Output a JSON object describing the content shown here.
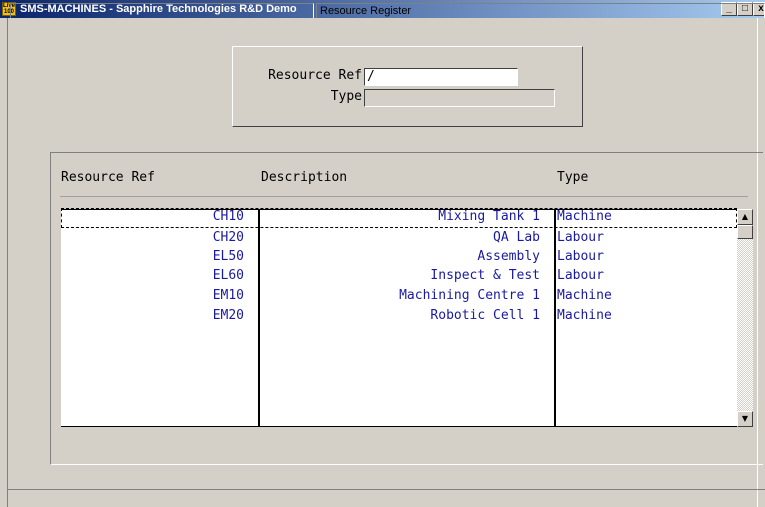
{
  "window": {
    "title": "SMS-MACHINES - Sapphire Technologies R&D Demo",
    "icon_text_top": "Live",
    "icon_text_bottom": "100",
    "minimize": "_",
    "maximize": "□",
    "close": "x"
  },
  "search": {
    "resource_ref_label": "Resource Ref",
    "resource_ref_value": "/",
    "type_label": "Type",
    "type_value": ""
  },
  "list": {
    "columns": [
      "Resource Ref",
      "Description",
      "Type"
    ],
    "rows": [
      {
        "ref": "CH10",
        "description": "Mixing Tank 1",
        "type": "Machine"
      },
      {
        "ref": "CH20",
        "description": "QA Lab",
        "type": "Labour"
      },
      {
        "ref": "EL50",
        "description": "Assembly",
        "type": "Labour"
      },
      {
        "ref": "EL60",
        "description": "Inspect & Test",
        "type": "Labour"
      },
      {
        "ref": "EM10",
        "description": "Machining Centre 1",
        "type": "Machine"
      },
      {
        "ref": "EM20",
        "description": "Robotic Cell 1",
        "type": "Machine"
      }
    ],
    "selected_row": 0
  },
  "scrollbar": {
    "up": "▲",
    "down": "▼"
  },
  "status": {
    "left": "",
    "center": "Resource Register"
  },
  "colors": {
    "row_text": "#1a1aa0",
    "title_start": "#0a246a",
    "title_end": "#a6caf0",
    "face": "#d4d0c8"
  }
}
